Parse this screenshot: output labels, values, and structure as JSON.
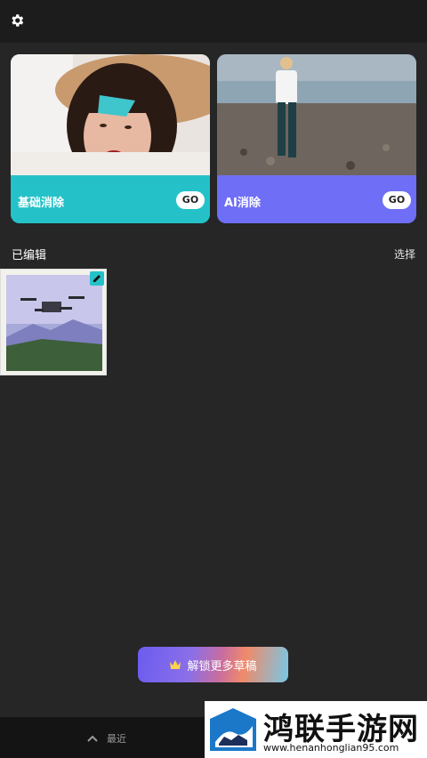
{
  "header": {
    "settings_icon": "gear-icon"
  },
  "cards": [
    {
      "label": "基础消除",
      "button": "GO",
      "color": "#24c2c8"
    },
    {
      "label": "AI消除",
      "button": "GO",
      "color": "#6f6ef6"
    }
  ],
  "edited": {
    "title": "已编辑",
    "select_label": "选择",
    "draft_icon": "pencil-icon"
  },
  "unlock": {
    "label": "解锁更多草稿",
    "icon": "crown-icon"
  },
  "bottom_nav": {
    "recent_label": "最近",
    "icon": "chevron-up-icon"
  },
  "watermark": {
    "title": "鸿联手游网",
    "url": "www.henanhonglian95.com"
  }
}
